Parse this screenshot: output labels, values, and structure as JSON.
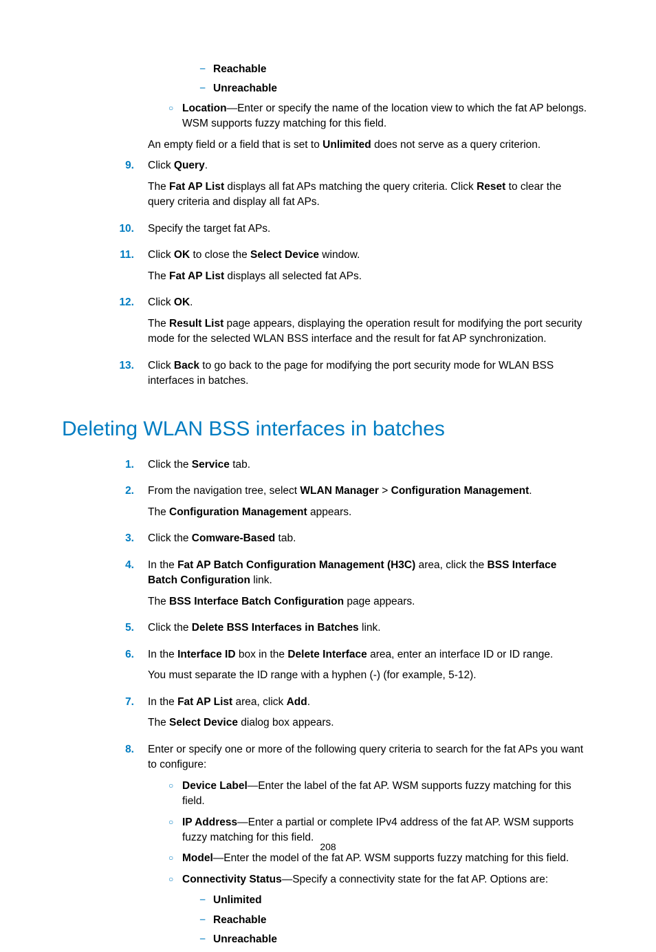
{
  "page_number": "208",
  "top_dashes": [
    "Reachable",
    "Unreachable"
  ],
  "location_item": {
    "label": "Location",
    "text": "—Enter or specify the name of the location view to which the fat AP belongs. WSM supports fuzzy matching for this field."
  },
  "empty_field_note_pre": "An empty field or a field that is set to ",
  "empty_field_bold": "Unlimited",
  "empty_field_note_post": " does not serve as a query criterion.",
  "steps_a": [
    {
      "num": "9.",
      "para1_pre": "Click ",
      "para1_b1": "Query",
      "para1_post": ".",
      "para2_pre": "The ",
      "para2_b1": "Fat AP List",
      "para2_mid": " displays all fat APs matching the query criteria. Click ",
      "para2_b2": "Reset",
      "para2_post": " to clear the query criteria and display all fat APs."
    },
    {
      "num": "10.",
      "para1_pre": "Specify the target fat APs.",
      "para1_b1": "",
      "para1_post": ""
    },
    {
      "num": "11.",
      "para1_pre": "Click ",
      "para1_b1": "OK",
      "para1_mid": " to close the ",
      "para1_b2": "Select Device",
      "para1_post": " window.",
      "para2_pre": "The ",
      "para2_b1": "Fat AP List",
      "para2_post": " displays all selected fat APs."
    },
    {
      "num": "12.",
      "para1_pre": "Click ",
      "para1_b1": "OK",
      "para1_post": ".",
      "para2_pre": "The ",
      "para2_b1": "Result List",
      "para2_post": " page appears, displaying the operation result for modifying the port security mode for the selected WLAN BSS interface and the result for fat AP synchronization."
    },
    {
      "num": "13.",
      "para1_pre": "Click ",
      "para1_b1": "Back",
      "para1_post": " to go back to the page for modifying the port security mode for WLAN BSS interfaces in batches."
    }
  ],
  "heading": "Deleting WLAN BSS interfaces in batches",
  "steps_b": {
    "s1": {
      "num": "1.",
      "pre": "Click the ",
      "b1": "Service",
      "post": " tab."
    },
    "s2": {
      "num": "2.",
      "pre": "From the navigation tree, select ",
      "b1": "WLAN Manager",
      "mid": " > ",
      "b2": "Configuration Management",
      "post": ".",
      "p2pre": "The ",
      "p2b": "Configuration Management",
      "p2post": " appears."
    },
    "s3": {
      "num": "3.",
      "pre": "Click the ",
      "b1": "Comware-Based",
      "post": " tab."
    },
    "s4": {
      "num": "4.",
      "pre": "In the ",
      "b1": "Fat AP Batch Configuration Management (H3C)",
      "mid": " area, click the ",
      "b2": "BSS Interface Batch Configuration",
      "post": " link.",
      "p2pre": "The ",
      "p2b": "BSS Interface Batch Configuration",
      "p2post": " page appears."
    },
    "s5": {
      "num": "5.",
      "pre": "Click the ",
      "b1": "Delete BSS Interfaces in Batches",
      "post": " link."
    },
    "s6": {
      "num": "6.",
      "pre": "In the ",
      "b1": "Interface ID",
      "mid": " box in the ",
      "b2": "Delete Interface",
      "post": " area, enter an interface ID or ID range.",
      "p2": "You must separate the ID range with a hyphen (-) (for example, 5-12)."
    },
    "s7": {
      "num": "7.",
      "pre": "In the ",
      "b1": "Fat AP List",
      "mid": " area, click ",
      "b2": "Add",
      "post": ".",
      "p2pre": "The ",
      "p2b": "Select Device",
      "p2post": " dialog box appears."
    },
    "s8": {
      "num": "8.",
      "text": "Enter or specify one or more of the following query criteria to search for the fat APs you want to configure:",
      "bullets": [
        {
          "label": "Device Label",
          "text": "—Enter the label of the fat AP. WSM supports fuzzy matching for this field."
        },
        {
          "label": "IP Address",
          "text": "—Enter a partial or complete IPv4 address of the fat AP. WSM supports fuzzy matching for this field."
        },
        {
          "label": "Model",
          "text": "—Enter the model of the fat AP. WSM supports fuzzy matching for this field."
        },
        {
          "label": "Connectivity Status",
          "text": "—Specify a connectivity state for the fat AP. Options are:"
        }
      ],
      "dashes": [
        "Unlimited",
        "Reachable",
        "Unreachable"
      ]
    }
  }
}
